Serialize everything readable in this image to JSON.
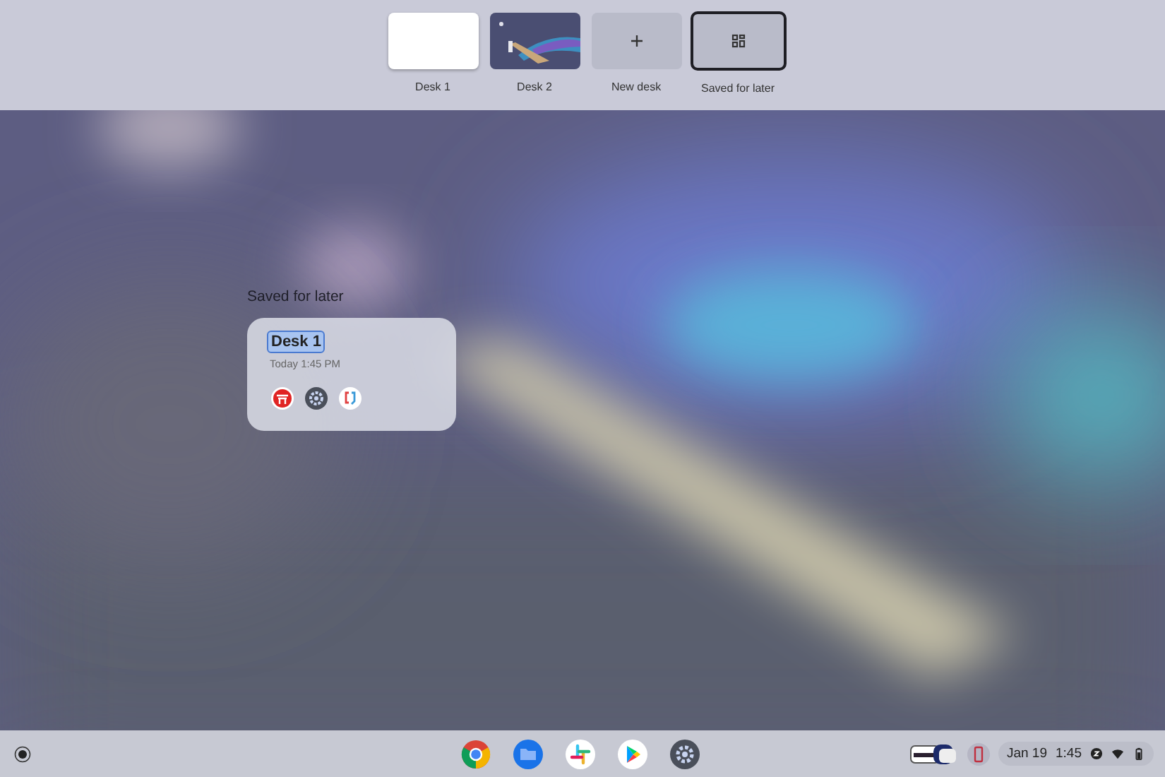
{
  "desks": [
    {
      "label": "Desk 1",
      "kind": "window",
      "selected": false
    },
    {
      "label": "Desk 2",
      "kind": "picture",
      "selected": false
    },
    {
      "label": "New desk",
      "kind": "new",
      "selected": false
    },
    {
      "label": "Saved for later",
      "kind": "saved",
      "selected": true
    }
  ],
  "saved": {
    "heading": "Saved for later",
    "cards": [
      {
        "name": "Desk 1",
        "editing": true,
        "time": "Today 1:45 PM",
        "apps": [
          {
            "kind": "shrine"
          },
          {
            "kind": "gear"
          },
          {
            "kind": "chat"
          }
        ]
      }
    ]
  },
  "shelf": {
    "apps": [
      {
        "kind": "chrome"
      },
      {
        "kind": "files"
      },
      {
        "kind": "slack"
      },
      {
        "kind": "play"
      },
      {
        "kind": "settings"
      }
    ],
    "date": "Jan 19",
    "time": "1:45"
  }
}
